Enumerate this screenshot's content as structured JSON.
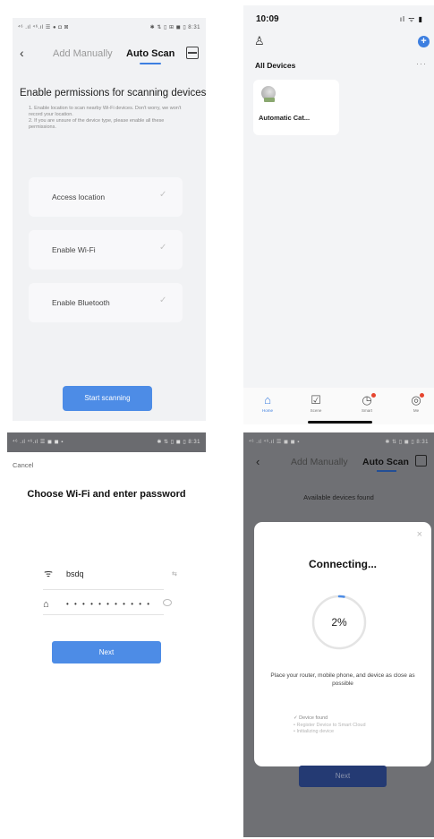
{
  "screen1": {
    "status_left": "⁴⁶ .ıl ⁴⁶.ıl ☰ ● ◘ ⊠",
    "status_right": "✱ ⇅ ▯ ⊞ ◼ ▯ 8:31",
    "tab_manual": "Add Manually",
    "tab_auto": "Auto Scan",
    "title": "Enable permissions for scanning devices",
    "note1": "1. Enable location to scan nearby Wi-Fi devices. Don't worry, we won't record your location.",
    "note2": "2. If you are unsure of the device type, please enable all these permissions.",
    "permissions": [
      {
        "label": "Access location",
        "check": "✓"
      },
      {
        "label": "Enable Wi-Fi",
        "check": "✓"
      },
      {
        "label": "Enable Bluetooth",
        "check": "✓"
      }
    ],
    "start_button": "Start scanning"
  },
  "screen2": {
    "time": "10:09",
    "system_icons": "ıl ᯤ ▮",
    "all_devices": "All Devices",
    "more": "···",
    "device_name": "Automatic Cat...",
    "tabs": [
      {
        "label": "Home",
        "icon": "⌂"
      },
      {
        "label": "Scene",
        "icon": "☑"
      },
      {
        "label": "Smart",
        "icon": "◷"
      },
      {
        "label": "Me",
        "icon": "◎"
      }
    ]
  },
  "screen3": {
    "status_left": "⁴⁶ .ıl ⁴⁶.ıl ☰ ◼ ◼ ▪",
    "status_right": "✱ ⇅ ▯ ◼ ▯ 8:31",
    "cancel": "Cancel",
    "title": "Choose Wi-Fi and enter password",
    "ssid": "bsdq",
    "swap": "⇆",
    "password_mask": "• • • • • • • • • • •",
    "next": "Next"
  },
  "screen4": {
    "status_left": "⁴⁶ .ıl ⁴⁶.ıl ☰ ◼ ◼ ▪",
    "status_right": "✱ ⇅ ▯ ◼ ▯ 8:31",
    "tab_manual": "Add Manually",
    "tab_auto": "Auto Scan",
    "available": "Available devices found",
    "close": "×",
    "connecting": "Connecting...",
    "percent": "2%",
    "progress": 0.02,
    "tip": "Place your router, mobile phone, and device as close as possible",
    "steps": [
      {
        "mark": "✓",
        "text": "Device found"
      },
      {
        "mark": "•",
        "text": "Register Device to Smart Cloud"
      },
      {
        "mark": "•",
        "text": "Initializing device"
      }
    ],
    "next": "Next"
  },
  "colors": {
    "accent": "#4d8ce6",
    "dark_accent": "#243a73",
    "badge": "#e6452f"
  }
}
